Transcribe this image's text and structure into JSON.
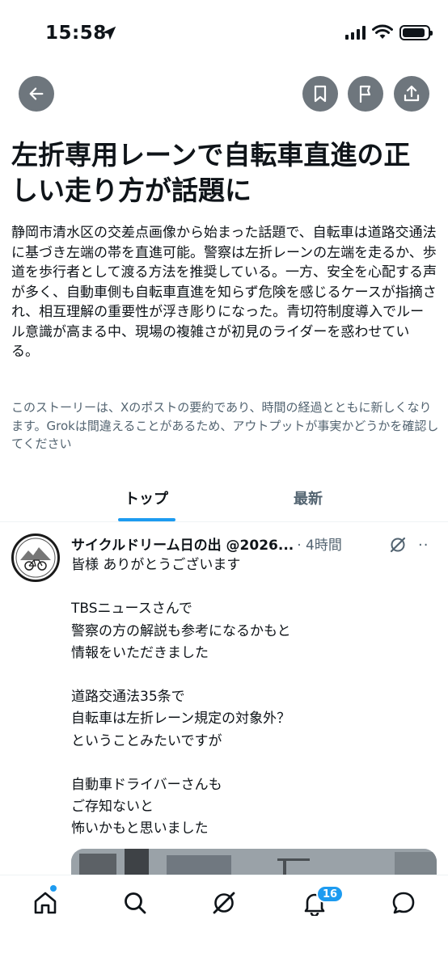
{
  "status_bar": {
    "time": "15:58",
    "battery_level": 0.9
  },
  "top_nav": {
    "back_icon": "arrow-left-icon",
    "bookmark_icon": "bookmark-icon",
    "flag_icon": "flag-icon",
    "share_icon": "share-icon"
  },
  "story": {
    "title": "左折専用レーンで自転車直進の正しい走り方が話題に",
    "summary": "静岡市清水区の交差点画像から始まった話題で、自転車は道路交通法に基づき左端の帯を直進可能。警察は左折レーンの左端を走るか、歩道を歩行者として渡る方法を推奨している。一方、安全を心配する声が多く、自動車側も自転車直進を知らず危険を感じるケースが指摘され、相互理解の重要性が浮き彫りになった。青切符制度導入でルール意識が高まる中、現場の複雑さが初見のライダーを惑わせている。",
    "disclaimer": "このストーリーは、Xのポストの要約であり、時間の経過とともに新しくなります。Grokは間違えることがあるため、アウトプットが事実かどうかを確認してください"
  },
  "tabs": [
    {
      "label": "トップ",
      "active": true
    },
    {
      "label": "最新",
      "active": false
    }
  ],
  "post": {
    "author": "サイクルドリーム日の出 @2026...",
    "time": "· 4時間",
    "body": "皆様 ありがとうございます\n\nTBSニュースさんで\n警察の方の解説も参考になるかもと\n情報をいただきました\n\n道路交通法35条で\n自転車は左折レーン規定の対象外？\nということみたいですが\n\n自動車ドライバーさんも\nご存知ないと\n怖いかもと思いました",
    "more": "··"
  },
  "bottom_nav": {
    "items": [
      "home-icon",
      "search-icon",
      "grok-icon",
      "notifications-icon",
      "messages-icon"
    ],
    "notification_count": "16"
  },
  "colors": {
    "accent": "#1d9bf0",
    "text": "#0f1419",
    "muted": "#536471",
    "button_bg": "#6e767d"
  }
}
